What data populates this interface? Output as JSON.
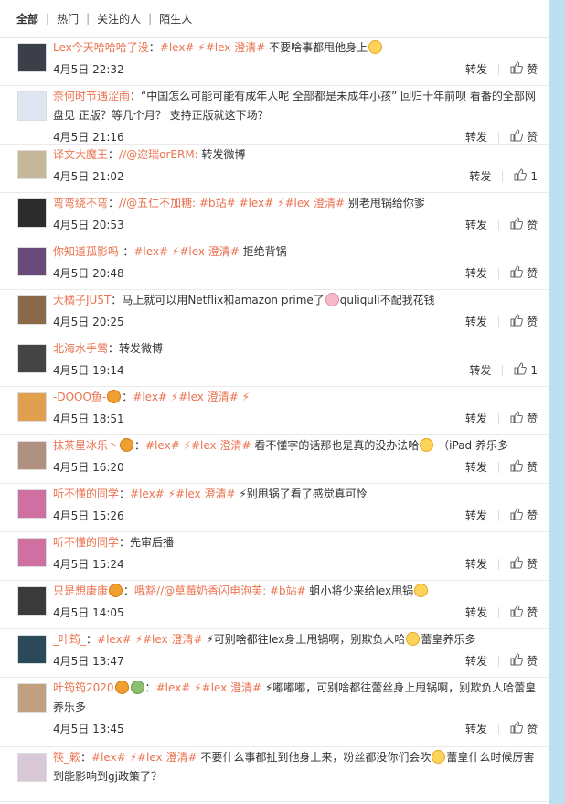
{
  "tabs": [
    {
      "label": "全部",
      "active": true
    },
    {
      "label": "热门",
      "active": false
    },
    {
      "label": "关注的人",
      "active": false
    },
    {
      "label": "陌生人",
      "active": false
    }
  ],
  "repost_label": "转发",
  "like_label": "赞",
  "items": [
    {
      "nick": "Lex今天哈哈哈了没",
      "colon": "：",
      "parts": [
        "#lex#",
        "⚡#lex 澄清#"
      ],
      "text": " 不要啥事都甩他身上",
      "emoji": "smile",
      "time": "4月5日 22:32",
      "likes": "赞",
      "avatar_color": "#3a3f4a"
    },
    {
      "nick": "奈何时节遇涩雨",
      "colon": "：",
      "parts": [],
      "text": "“中国怎么可能可能有成年人呢 全部都是未成年小孩” 回归十年前呗 看番的全部网盘见 正版？等几个月？ 支持正版就这下场？",
      "emoji": "",
      "time": "4月5日 21:16",
      "likes": "赞",
      "avatar_color": "#dfe6f2"
    },
    {
      "nick": "译文大魔王",
      "colon": "：",
      "parts": [
        "//@迩瑞orERM:"
      ],
      "text": "转发微博",
      "emoji": "",
      "time": "4月5日 21:02",
      "likes": "1",
      "avatar_color": "#c8b89a"
    },
    {
      "nick": "弯弯绕不弯",
      "colon": "：",
      "parts": [
        "//@五仁不加糖:",
        "#b站#",
        "#lex#",
        "⚡#lex 澄清#"
      ],
      "text": " 别老甩锅给你爹",
      "emoji": "",
      "time": "4月5日 20:53",
      "likes": "赞",
      "avatar_color": "#2b2b2b"
    },
    {
      "nick": "你知道孤影吗-",
      "colon": "：",
      "parts": [
        "#lex#",
        "⚡#lex 澄清#"
      ],
      "text": " 拒绝背锅",
      "emoji": "",
      "time": "4月5日 20:48",
      "likes": "赞",
      "avatar_color": "#6a4a7a"
    },
    {
      "nick": "大橘子JU5T",
      "colon": "：",
      "parts": [],
      "text": "马上就可以用Netflix和amazon prime了",
      "emoji": "pig",
      "text2": "quliquli不配我花钱",
      "time": "4月5日 20:25",
      "likes": "赞",
      "avatar_color": "#8a6a4a"
    },
    {
      "nick": "北海水手莺",
      "colon": "：",
      "parts": [],
      "text": "转发微博",
      "emoji": "",
      "time": "4月5日 19:14",
      "likes": "1",
      "avatar_color": "#444444"
    },
    {
      "nick": "-DOOO鱼-",
      "colon": "：",
      "parts": [
        "#lex#",
        "⚡#lex 澄清#",
        "⚡"
      ],
      "text": "",
      "emoji": "",
      "badge": "v",
      "time": "4月5日 18:51",
      "likes": "赞",
      "avatar_color": "#e0a050"
    },
    {
      "nick": "抹茶星冰乐丶",
      "colon": "：",
      "parts": [
        "#lex#",
        "⚡#lex 澄清#"
      ],
      "text": " 看不懂字的话那也是真的没办法哈",
      "emoji": "smile",
      "text2": " （iPad 养乐多",
      "badge": "v",
      "time": "4月5日 16:20",
      "likes": "赞",
      "avatar_color": "#b09080"
    },
    {
      "nick": "听不懂的同学",
      "colon": "：",
      "parts": [
        "#lex#",
        "⚡#lex 澄清#"
      ],
      "text": "⚡别甩锅了看了感觉真可怜",
      "emoji": "",
      "time": "4月5日 15:26",
      "likes": "赞",
      "avatar_color": "#d070a0"
    },
    {
      "nick": "听不懂的同学",
      "colon": "：",
      "parts": [],
      "text": "先审后播",
      "emoji": "",
      "time": "4月5日 15:24",
      "likes": "赞",
      "avatar_color": "#d070a0"
    },
    {
      "nick": "只是想康康",
      "colon": "：",
      "parts": [
        "哦豁//@草莓奶香闪电泡芙:",
        "#b站#"
      ],
      "text": " 蛆小将少来给lex甩锅",
      "emoji": "smile",
      "badge": "v",
      "time": "4月5日 14:05",
      "likes": "赞",
      "avatar_color": "#3a3a3a"
    },
    {
      "nick": "_叶筠_",
      "colon": "：",
      "parts": [
        "#lex#",
        "⚡#lex 澄清#"
      ],
      "text": "⚡可别啥都往lex身上甩锅啊，别欺负人哈",
      "emoji": "smile",
      "text2": "蕾皇养乐多",
      "time": "4月5日 13:47",
      "likes": "赞",
      "avatar_color": "#2a4a5a"
    },
    {
      "nick": "叶筠筠2020",
      "colon": "：",
      "parts": [
        "#lex#",
        "⚡#lex 澄清#"
      ],
      "text": "⚡嘟嘟嘟，可别啥都往蕾丝身上甩锅啊，别欺负人哈蕾皇养乐多",
      "emoji": "",
      "badge": "v",
      "badge2": "green",
      "time": "4月5日 13:45",
      "likes": "赞",
      "avatar_color": "#c0a080"
    },
    {
      "nick": "筷_簌",
      "colon": "：",
      "parts": [
        "#lex#",
        "⚡#lex 澄清#"
      ],
      "text": " 不要什么事都扯到他身上来，粉丝都没你们会吹",
      "emoji": "smile",
      "text2": "蕾皇什么时候厉害到能影响到gj政策了？",
      "time": "",
      "likes": "",
      "avatar_color": "#d8c8d8"
    }
  ]
}
